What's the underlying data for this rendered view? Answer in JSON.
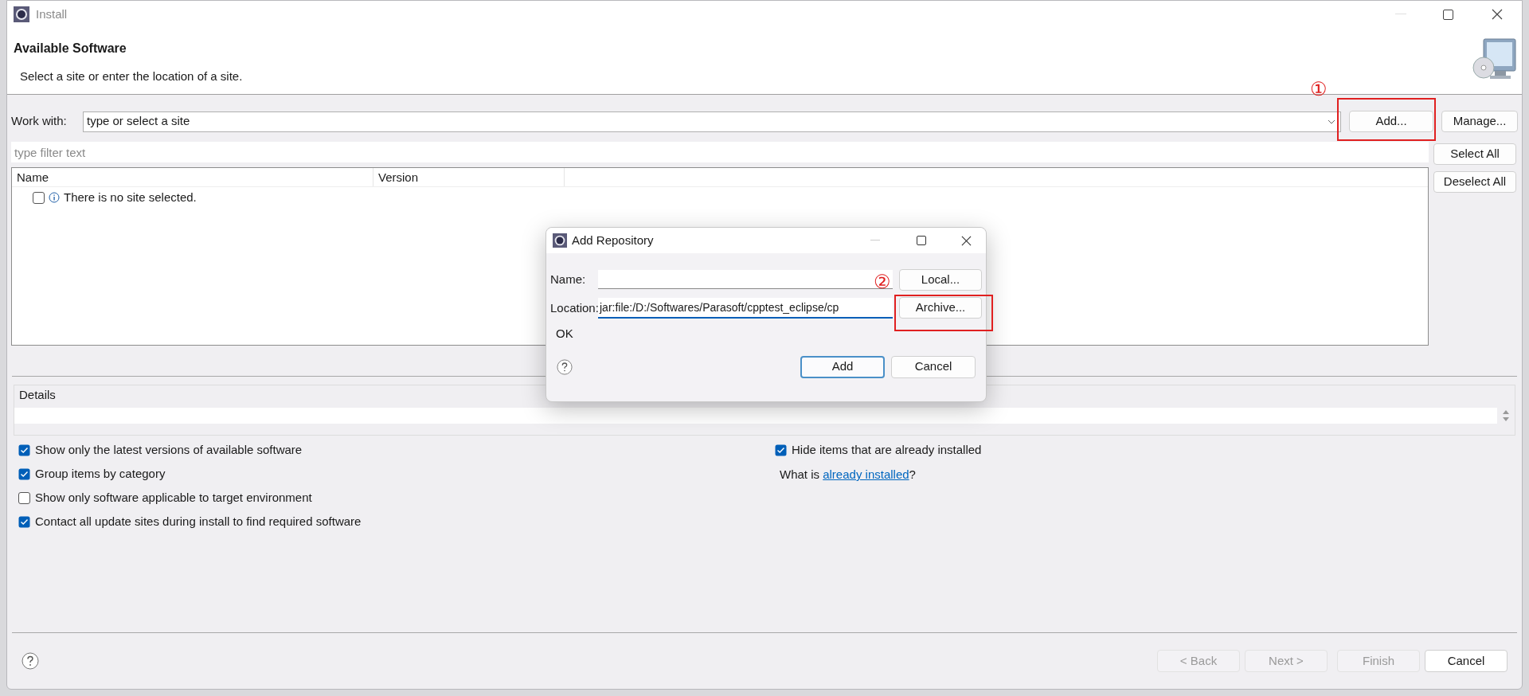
{
  "window": {
    "title": "Install"
  },
  "header": {
    "title": "Available Software",
    "subtitle": "Select a site or enter the location of a site."
  },
  "work_with": {
    "label": "Work with:",
    "value": "type or select a site"
  },
  "site_buttons": [
    {
      "label": "Add..."
    },
    {
      "label": "Manage..."
    }
  ],
  "filter": {
    "placeholder": "type filter text"
  },
  "side_buttons": [
    {
      "label": "Select All"
    },
    {
      "label": "Deselect All"
    }
  ],
  "tree": {
    "columns": [
      "Name",
      "Version"
    ],
    "rows": [
      {
        "text": "There is no site selected.",
        "checked": false
      }
    ]
  },
  "details": {
    "label": "Details"
  },
  "options": [
    {
      "label": "Show only the latest versions of available software",
      "checked": true
    },
    {
      "label": "Group items by category",
      "checked": true
    },
    {
      "label": "Show only software applicable to target environment",
      "checked": false
    },
    {
      "label": "Contact all update sites during install to find required software",
      "checked": true
    }
  ],
  "right_options": [
    {
      "label": "Hide items that are already installed",
      "checked": true
    }
  ],
  "installed_note": {
    "text": "What is ",
    "link": "already installed",
    "suffix": "?"
  },
  "footer_buttons": [
    {
      "label": "< Back",
      "disabled": true
    },
    {
      "label": "Next >",
      "disabled": true
    },
    {
      "label": "Finish",
      "disabled": true
    },
    {
      "label": "Cancel",
      "disabled": false
    }
  ],
  "dialog": {
    "title": "Add Repository",
    "name_label": "Name:",
    "location_label": "Location:",
    "location_value": "jar:file:/D:/Softwares/Parasoft/cpptest_eclipse/cp",
    "side_buttons": [
      {
        "label": "Local..."
      },
      {
        "label": "Archive..."
      }
    ],
    "status": "OK",
    "buttons": [
      {
        "label": "Add",
        "default": true
      },
      {
        "label": "Cancel",
        "default": false
      }
    ]
  },
  "annotations": [
    {
      "label": "①"
    },
    {
      "label": "②"
    }
  ]
}
